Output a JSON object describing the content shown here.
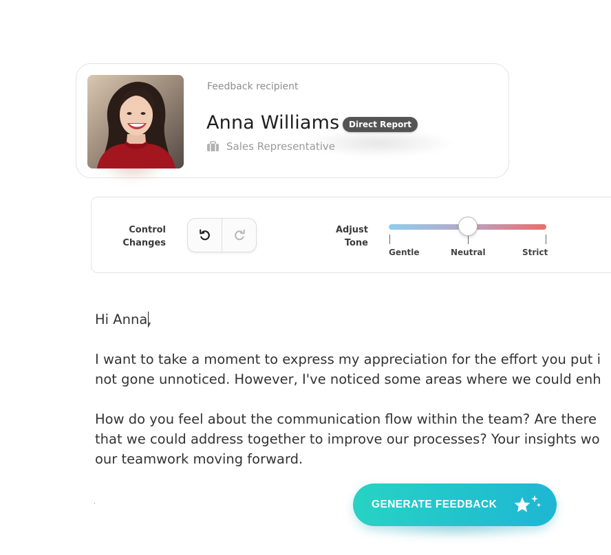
{
  "recipient": {
    "label": "Feedback recipient",
    "name": "Anna Williams",
    "relation_badge": "Direct Report",
    "role": "Sales Representative",
    "role_icon": "briefcase-icon",
    "avatar": "profile-photo"
  },
  "controls": {
    "control_changes_label_line1": "Control",
    "control_changes_label_line2": "Changes",
    "undo_icon": "undo-icon",
    "redo_icon": "redo-icon",
    "adjust_tone_label_line1": "Adjust",
    "adjust_tone_label_line2": "Tone",
    "tone_options": [
      "Gentle",
      "Neutral",
      "Strict"
    ],
    "tone_selected": "Neutral",
    "tone_value_fraction": 0.5,
    "tone_gradient": [
      "#8fcdee",
      "#b7a6c4",
      "#ea6c6c"
    ]
  },
  "editor": {
    "greeting": "Hi Anna,",
    "paragraph1_line1": "I want to take a moment to express my appreciation for the effort you put i",
    "paragraph1_line2": "not gone unnoticed. However, I've noticed some areas where we could enh",
    "paragraph2_line1": "How do you feel about the communication flow within the team? Are there",
    "paragraph2_line2": "that we could address together to improve our processes? Your insights wo",
    "paragraph2_line3": "our teamwork moving forward."
  },
  "generate_button": {
    "label": "GENERATE FEEDBACK",
    "icon": "sparkle-star-icon",
    "colors": [
      "#27d3c3",
      "#1eb6d4"
    ]
  }
}
